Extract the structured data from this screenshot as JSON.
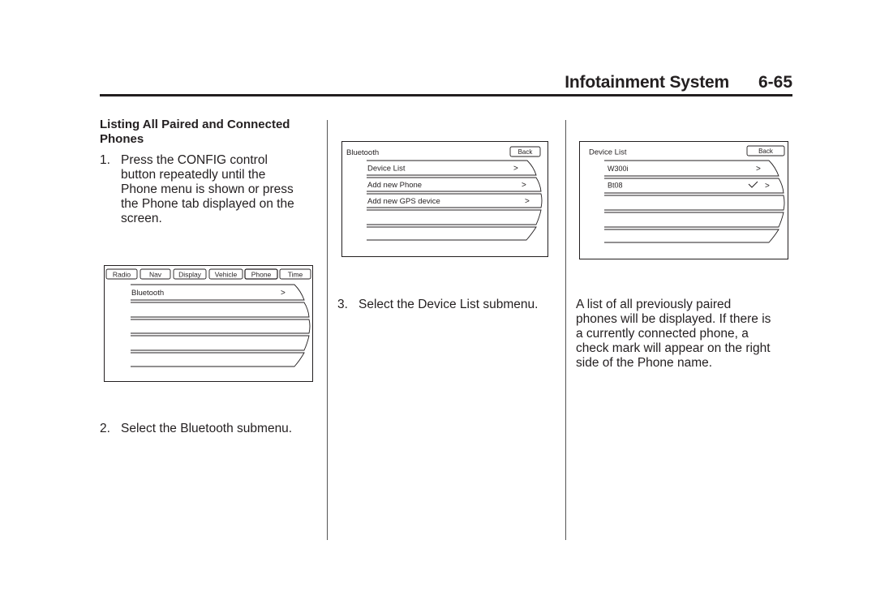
{
  "header": {
    "section_title": "Infotainment System",
    "page_number": "6-65"
  },
  "column1": {
    "heading": "Listing All Paired and Connected Phones",
    "step1": {
      "number": "1.",
      "lines": [
        "Press the CONFIG control",
        "button repeatedly until the",
        "Phone menu is shown or press",
        "the Phone tab displayed on the",
        "screen."
      ]
    },
    "screen": {
      "tabs": [
        "Radio",
        "Nav",
        "Display",
        "Vehicle",
        "Phone",
        "Time"
      ],
      "menu_items": [
        {
          "label": "Bluetooth",
          "arrow": ">"
        }
      ]
    },
    "step2": {
      "number": "2.",
      "text": "Select the Bluetooth submenu."
    }
  },
  "column2": {
    "screen": {
      "title": "Bluetooth",
      "back_label": "Back",
      "menu_items": [
        {
          "label": "Device List",
          "arrow": ">"
        },
        {
          "label": "Add new Phone",
          "arrow": ">"
        },
        {
          "label": "Add new GPS device",
          "arrow": ">"
        }
      ]
    },
    "step3": {
      "number": "3.",
      "text": "Select the Device List submenu."
    }
  },
  "column3": {
    "screen": {
      "title": "Device List",
      "back_label": "Back",
      "menu_items": [
        {
          "label": "W300i",
          "arrow": ">",
          "connected": false
        },
        {
          "label": "Bt08",
          "arrow": ">",
          "connected": true,
          "check": "✓"
        }
      ]
    },
    "paragraph_lines": [
      "A list of all previously paired",
      "phones will be displayed. If there is",
      "a currently connected phone, a",
      "check mark will appear on the right",
      "side of the Phone name."
    ]
  }
}
